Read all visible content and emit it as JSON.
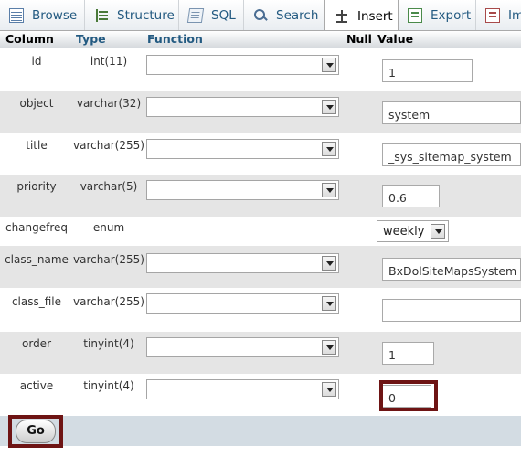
{
  "tabs": [
    {
      "label": "Browse",
      "icon": "browse-icon"
    },
    {
      "label": "Structure",
      "icon": "structure-icon"
    },
    {
      "label": "SQL",
      "icon": "sql-icon"
    },
    {
      "label": "Search",
      "icon": "search-icon"
    },
    {
      "label": "Insert",
      "icon": "insert-icon",
      "active": true
    },
    {
      "label": "Export",
      "icon": "export-icon"
    },
    {
      "label": "Im",
      "icon": "import-icon"
    }
  ],
  "table": {
    "headers": {
      "column": "Column",
      "type": "Type",
      "function": "Function",
      "null": "Null",
      "value": "Value"
    },
    "rows": [
      {
        "name": "id",
        "type": "int(11)",
        "value": "1"
      },
      {
        "name": "object",
        "type": "varchar(32)",
        "value": "system"
      },
      {
        "name": "title",
        "type": "varchar(255)",
        "value": "_sys_sitemap_system"
      },
      {
        "name": "priority",
        "type": "varchar(5)",
        "value": "0.6"
      },
      {
        "name": "changefreq",
        "type": "enum",
        "function": "--",
        "value": "weekly"
      },
      {
        "name": "class_name",
        "type": "varchar(255)",
        "value": "BxDolSiteMapsSystem"
      },
      {
        "name": "class_file",
        "type": "varchar(255)",
        "value": ""
      },
      {
        "name": "order",
        "type": "tinyint(4)",
        "value": "1"
      },
      {
        "name": "active",
        "type": "tinyint(4)",
        "value": "0"
      }
    ]
  },
  "footer": {
    "go_label": "Go"
  },
  "colors": {
    "highlight": "#6e1414",
    "link": "#235a81",
    "row_alt": "#e5e5e5",
    "footer": "#d3dce3"
  }
}
